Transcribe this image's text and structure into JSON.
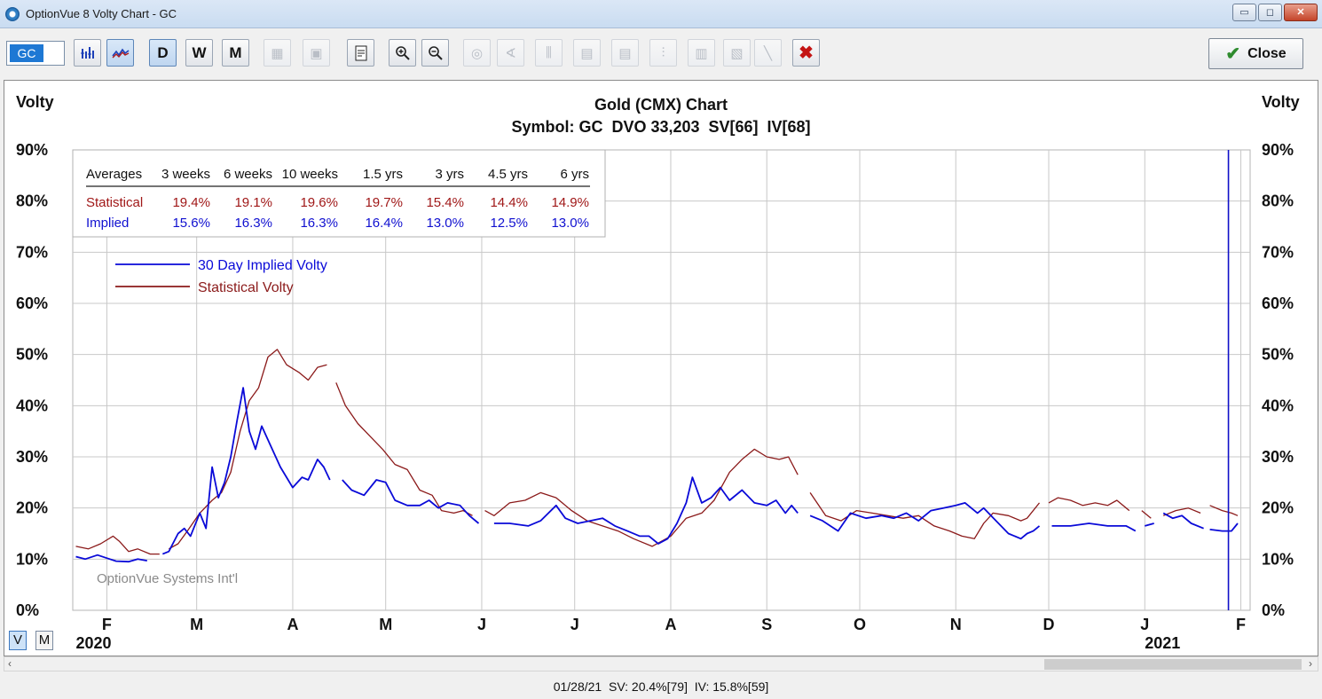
{
  "window": {
    "title": "OptionVue 8 Volty Chart - GC",
    "controls": {
      "minimize": "▭",
      "maximize": "◻",
      "close": "✕"
    }
  },
  "toolbar": {
    "symbol": "GC",
    "period_day": "D",
    "period_week": "W",
    "period_month": "M",
    "close_label": "Close",
    "close_icon": "✔",
    "delete_icon": "✖"
  },
  "chart_data": {
    "type": "line",
    "title": "Gold (CMX) Chart",
    "subtitle": "Symbol: GC  DVO 33,203  SV[66]  IV[68]",
    "ylabel": "Volty",
    "y_ticks": [
      "90%",
      "80%",
      "70%",
      "60%",
      "50%",
      "40%",
      "30%",
      "20%",
      "10%",
      "0%"
    ],
    "ylim": [
      0,
      90
    ],
    "x_ticks": [
      {
        "label": "F",
        "date": "2020-02-01"
      },
      {
        "label": "M",
        "date": "2020-03-01"
      },
      {
        "label": "A",
        "date": "2020-04-01"
      },
      {
        "label": "M",
        "date": "2020-05-01"
      },
      {
        "label": "J",
        "date": "2020-06-01"
      },
      {
        "label": "J",
        "date": "2020-07-01"
      },
      {
        "label": "A",
        "date": "2020-08-01"
      },
      {
        "label": "S",
        "date": "2020-09-01"
      },
      {
        "label": "O",
        "date": "2020-10-01"
      },
      {
        "label": "N",
        "date": "2020-11-01"
      },
      {
        "label": "D",
        "date": "2020-12-01"
      },
      {
        "label": "J",
        "date": "2021-01-01"
      },
      {
        "label": "F",
        "date": "2021-02-01"
      }
    ],
    "year_labels": [
      {
        "label": "2020",
        "date": "2020-01-22"
      },
      {
        "label": "2021",
        "date": "2021-01-01"
      }
    ],
    "xlim": [
      "2020-01-21",
      "2021-02-04"
    ],
    "grid": true,
    "cursor_date": "2021-01-28",
    "watermark": "OptionVue Systems Int'l",
    "averages_table": {
      "headers": [
        "Averages",
        "3 weeks",
        "6 weeks",
        "10 weeks",
        "1.5 yrs",
        "3 yrs",
        "4.5 yrs",
        "6 yrs"
      ],
      "rows": [
        {
          "name": "Statistical",
          "color": "#a01818",
          "values": [
            "19.4%",
            "19.1%",
            "19.6%",
            "19.7%",
            "15.4%",
            "14.4%",
            "14.9%"
          ]
        },
        {
          "name": "Implied",
          "color": "#1010d0",
          "values": [
            "15.6%",
            "16.3%",
            "16.3%",
            "16.4%",
            "13.0%",
            "12.5%",
            "13.0%"
          ]
        }
      ]
    },
    "legend_placement": "top-left",
    "series": [
      {
        "name": "30 Day Implied Volty",
        "color": "#0a0ad8",
        "segments": [
          [
            [
              "2020-01-22",
              10.5
            ],
            [
              "2020-01-25",
              10.0
            ],
            [
              "2020-01-29",
              10.8
            ],
            [
              "2020-02-01",
              10.2
            ],
            [
              "2020-02-04",
              9.6
            ],
            [
              "2020-02-08",
              9.5
            ],
            [
              "2020-02-11",
              10.0
            ],
            [
              "2020-02-14",
              9.7
            ]
          ],
          [
            [
              "2020-02-19",
              11.0
            ],
            [
              "2020-02-21",
              11.5
            ],
            [
              "2020-02-24",
              15.0
            ],
            [
              "2020-02-26",
              16.0
            ],
            [
              "2020-02-28",
              14.5
            ],
            [
              "2020-03-02",
              19.0
            ],
            [
              "2020-03-04",
              16.0
            ],
            [
              "2020-03-06",
              28.0
            ],
            [
              "2020-03-08",
              22.0
            ],
            [
              "2020-03-10",
              25.0
            ],
            [
              "2020-03-12",
              30.0
            ],
            [
              "2020-03-14",
              37.0
            ],
            [
              "2020-03-16",
              43.5
            ],
            [
              "2020-03-18",
              35.0
            ],
            [
              "2020-03-20",
              31.5
            ],
            [
              "2020-03-22",
              36.0
            ],
            [
              "2020-03-25",
              32.0
            ],
            [
              "2020-03-28",
              28.0
            ],
            [
              "2020-04-01",
              24.0
            ],
            [
              "2020-04-04",
              26.0
            ],
            [
              "2020-04-06",
              25.5
            ],
            [
              "2020-04-09",
              29.5
            ],
            [
              "2020-04-11",
              28.0
            ],
            [
              "2020-04-13",
              25.5
            ]
          ],
          [
            [
              "2020-04-17",
              25.5
            ],
            [
              "2020-04-20",
              23.5
            ],
            [
              "2020-04-24",
              22.5
            ],
            [
              "2020-04-28",
              25.5
            ],
            [
              "2020-05-01",
              25.0
            ],
            [
              "2020-05-04",
              21.5
            ],
            [
              "2020-05-08",
              20.5
            ],
            [
              "2020-05-12",
              20.5
            ],
            [
              "2020-05-15",
              21.5
            ],
            [
              "2020-05-18",
              20.0
            ],
            [
              "2020-05-21",
              21.0
            ],
            [
              "2020-05-25",
              20.5
            ],
            [
              "2020-05-28",
              18.5
            ],
            [
              "2020-05-31",
              17.0
            ]
          ],
          [
            [
              "2020-06-05",
              17.0
            ],
            [
              "2020-06-10",
              17.0
            ],
            [
              "2020-06-16",
              16.5
            ],
            [
              "2020-06-20",
              17.5
            ],
            [
              "2020-06-25",
              20.5
            ],
            [
              "2020-06-28",
              18.0
            ],
            [
              "2020-07-02",
              17.0
            ],
            [
              "2020-07-06",
              17.5
            ],
            [
              "2020-07-10",
              18.0
            ],
            [
              "2020-07-14",
              16.5
            ],
            [
              "2020-07-18",
              15.5
            ],
            [
              "2020-07-22",
              14.5
            ],
            [
              "2020-07-25",
              14.5
            ],
            [
              "2020-07-28",
              13.0
            ],
            [
              "2020-07-31",
              14.0
            ],
            [
              "2020-08-03",
              17.0
            ],
            [
              "2020-08-06",
              21.0
            ],
            [
              "2020-08-08",
              26.0
            ],
            [
              "2020-08-11",
              21.0
            ],
            [
              "2020-08-14",
              22.0
            ],
            [
              "2020-08-17",
              24.0
            ],
            [
              "2020-08-20",
              21.5
            ],
            [
              "2020-08-24",
              23.5
            ],
            [
              "2020-08-28",
              21.0
            ],
            [
              "2020-09-01",
              20.5
            ],
            [
              "2020-09-04",
              21.5
            ],
            [
              "2020-09-07",
              19.0
            ],
            [
              "2020-09-09",
              20.5
            ],
            [
              "2020-09-11",
              19.0
            ]
          ],
          [
            [
              "2020-09-15",
              18.5
            ],
            [
              "2020-09-19",
              17.5
            ],
            [
              "2020-09-24",
              15.5
            ],
            [
              "2020-09-28",
              19.0
            ],
            [
              "2020-10-03",
              18.0
            ],
            [
              "2020-10-08",
              18.5
            ],
            [
              "2020-10-12",
              18.0
            ],
            [
              "2020-10-16",
              19.0
            ],
            [
              "2020-10-20",
              17.5
            ],
            [
              "2020-10-24",
              19.5
            ],
            [
              "2020-10-28",
              20.0
            ],
            [
              "2020-11-01",
              20.5
            ],
            [
              "2020-11-04",
              21.0
            ],
            [
              "2020-11-08",
              19.0
            ],
            [
              "2020-11-10",
              20.0
            ],
            [
              "2020-11-14",
              17.5
            ],
            [
              "2020-11-18",
              15.0
            ],
            [
              "2020-11-22",
              14.0
            ],
            [
              "2020-11-24",
              15.0
            ],
            [
              "2020-11-26",
              15.5
            ],
            [
              "2020-11-28",
              16.5
            ]
          ],
          [
            [
              "2020-12-02",
              16.5
            ],
            [
              "2020-12-08",
              16.5
            ],
            [
              "2020-12-14",
              17.0
            ],
            [
              "2020-12-20",
              16.5
            ],
            [
              "2020-12-26",
              16.5
            ],
            [
              "2020-12-29",
              15.5
            ]
          ],
          [
            [
              "2021-01-01",
              16.5
            ],
            [
              "2021-01-04",
              17.0
            ]
          ],
          [
            [
              "2021-01-07",
              19.0
            ],
            [
              "2021-01-10",
              18.0
            ],
            [
              "2021-01-13",
              18.5
            ],
            [
              "2021-01-16",
              17.0
            ],
            [
              "2021-01-20",
              16.0
            ]
          ],
          [
            [
              "2021-01-22",
              15.8
            ],
            [
              "2021-01-26",
              15.5
            ],
            [
              "2021-01-29",
              15.5
            ],
            [
              "2021-01-31",
              17.0
            ]
          ]
        ]
      },
      {
        "name": "Statistical Volty",
        "color": "#8b1a1a",
        "segments": [
          [
            [
              "2020-01-22",
              12.5
            ],
            [
              "2020-01-26",
              12.0
            ],
            [
              "2020-01-30",
              13.0
            ],
            [
              "2020-02-03",
              14.5
            ],
            [
              "2020-02-05",
              13.5
            ],
            [
              "2020-02-08",
              11.5
            ],
            [
              "2020-02-11",
              12.0
            ],
            [
              "2020-02-15",
              11.0
            ],
            [
              "2020-02-18",
              11.0
            ]
          ],
          [
            [
              "2020-02-21",
              12.0
            ],
            [
              "2020-02-24",
              13.0
            ],
            [
              "2020-02-27",
              15.5
            ],
            [
              "2020-03-02",
              19.0
            ],
            [
              "2020-03-06",
              21.5
            ],
            [
              "2020-03-09",
              23.0
            ],
            [
              "2020-03-12",
              27.0
            ],
            [
              "2020-03-15",
              35.0
            ],
            [
              "2020-03-18",
              41.0
            ],
            [
              "2020-03-21",
              43.5
            ],
            [
              "2020-03-24",
              49.5
            ],
            [
              "2020-03-27",
              51.0
            ],
            [
              "2020-03-30",
              48.0
            ],
            [
              "2020-04-03",
              46.5
            ],
            [
              "2020-04-06",
              45.0
            ],
            [
              "2020-04-09",
              47.5
            ],
            [
              "2020-04-12",
              48.0
            ]
          ],
          [
            [
              "2020-04-15",
              44.5
            ],
            [
              "2020-04-18",
              40.0
            ],
            [
              "2020-04-22",
              36.5
            ],
            [
              "2020-04-26",
              34.0
            ],
            [
              "2020-04-30",
              31.5
            ],
            [
              "2020-05-04",
              28.5
            ],
            [
              "2020-05-08",
              27.5
            ],
            [
              "2020-05-12",
              23.5
            ],
            [
              "2020-05-16",
              22.5
            ],
            [
              "2020-05-19",
              19.5
            ],
            [
              "2020-05-23",
              19.0
            ],
            [
              "2020-05-26",
              19.5
            ],
            [
              "2020-05-29",
              18.5
            ]
          ],
          [
            [
              "2020-06-02",
              19.5
            ],
            [
              "2020-06-05",
              18.5
            ],
            [
              "2020-06-10",
              21.0
            ],
            [
              "2020-06-15",
              21.5
            ],
            [
              "2020-06-20",
              23.0
            ],
            [
              "2020-06-25",
              22.0
            ],
            [
              "2020-06-30",
              19.5
            ],
            [
              "2020-07-05",
              17.5
            ],
            [
              "2020-07-10",
              16.5
            ],
            [
              "2020-07-15",
              15.5
            ],
            [
              "2020-07-20",
              14.0
            ],
            [
              "2020-07-26",
              12.5
            ],
            [
              "2020-08-01",
              14.5
            ],
            [
              "2020-08-06",
              18.0
            ],
            [
              "2020-08-11",
              19.0
            ],
            [
              "2020-08-15",
              21.5
            ],
            [
              "2020-08-20",
              27.0
            ],
            [
              "2020-08-24",
              29.5
            ],
            [
              "2020-08-28",
              31.5
            ],
            [
              "2020-09-01",
              30.0
            ],
            [
              "2020-09-05",
              29.5
            ],
            [
              "2020-09-08",
              30.0
            ],
            [
              "2020-09-11",
              26.5
            ]
          ],
          [
            [
              "2020-09-15",
              23.0
            ],
            [
              "2020-09-20",
              18.5
            ],
            [
              "2020-09-25",
              17.5
            ],
            [
              "2020-09-30",
              19.5
            ],
            [
              "2020-10-05",
              19.0
            ],
            [
              "2020-10-10",
              18.5
            ],
            [
              "2020-10-15",
              18.0
            ],
            [
              "2020-10-20",
              18.5
            ],
            [
              "2020-10-25",
              16.5
            ],
            [
              "2020-10-30",
              15.5
            ],
            [
              "2020-11-03",
              14.5
            ],
            [
              "2020-11-07",
              14.0
            ],
            [
              "2020-11-10",
              17.0
            ],
            [
              "2020-11-13",
              19.0
            ],
            [
              "2020-11-18",
              18.5
            ],
            [
              "2020-11-22",
              17.5
            ],
            [
              "2020-11-24",
              18.0
            ],
            [
              "2020-11-28",
              21.0
            ]
          ],
          [
            [
              "2020-12-01",
              21.0
            ],
            [
              "2020-12-04",
              22.0
            ],
            [
              "2020-12-08",
              21.5
            ],
            [
              "2020-12-12",
              20.5
            ],
            [
              "2020-12-16",
              21.0
            ],
            [
              "2020-12-20",
              20.5
            ],
            [
              "2020-12-23",
              21.5
            ],
            [
              "2020-12-27",
              19.5
            ]
          ],
          [
            [
              "2020-12-31",
              19.5
            ],
            [
              "2021-01-03",
              18.0
            ]
          ],
          [
            [
              "2021-01-07",
              18.5
            ],
            [
              "2021-01-11",
              19.5
            ],
            [
              "2021-01-15",
              20.0
            ],
            [
              "2021-01-19",
              19.0
            ]
          ],
          [
            [
              "2021-01-22",
              20.5
            ],
            [
              "2021-01-26",
              19.5
            ],
            [
              "2021-01-29",
              19.0
            ],
            [
              "2021-01-31",
              18.5
            ]
          ]
        ]
      }
    ]
  },
  "period_selector": {
    "v": "V",
    "m": "M"
  },
  "status": {
    "text": "01/28/21  SV: 20.4%[79]  IV: 15.8%[59]"
  },
  "scroll": {
    "left_arrow": "‹",
    "right_arrow": "›"
  }
}
